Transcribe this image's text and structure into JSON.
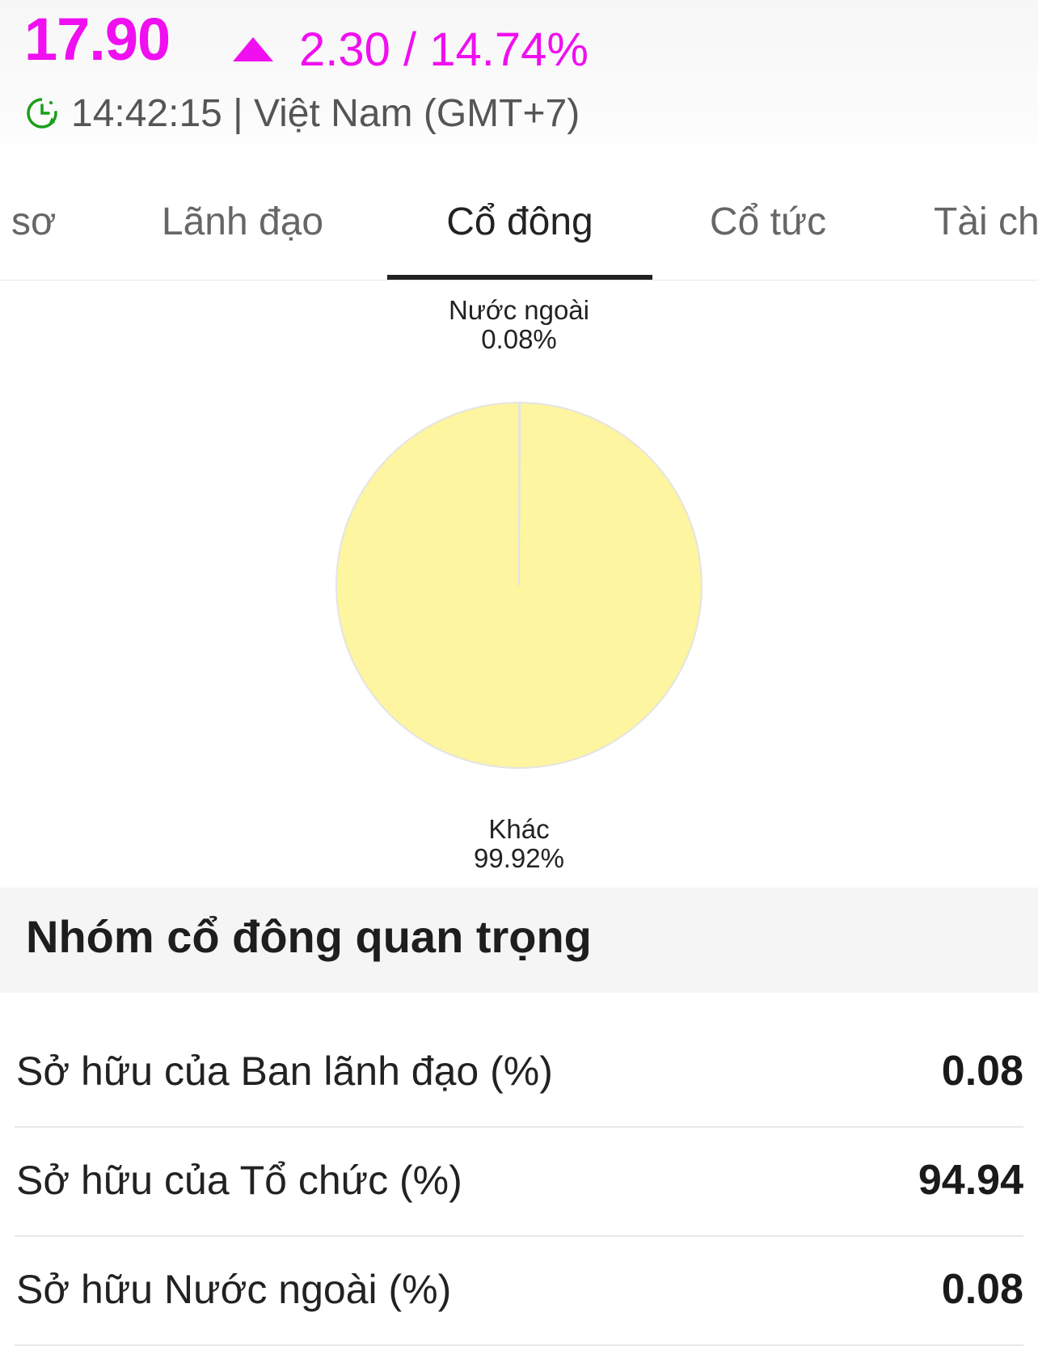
{
  "quote": {
    "price": "17.90",
    "change": "2.30 / 14.74%",
    "time": "14:42:15 | Việt Nam (GMT+7)",
    "color": "#f00ff0",
    "direction": "up"
  },
  "tabs": [
    {
      "label": "sơ",
      "active": false
    },
    {
      "label": "Lãnh đạo",
      "active": false
    },
    {
      "label": "Cổ đông",
      "active": true
    },
    {
      "label": "Cổ tức",
      "active": false
    },
    {
      "label": "Tài ch",
      "active": false
    }
  ],
  "chart_data": {
    "type": "pie",
    "slices": [
      {
        "label": "Nước ngoài",
        "value": 0.08,
        "display": "0.08%",
        "color": "#cfcfcf"
      },
      {
        "label": "Khác",
        "value": 99.92,
        "display": "99.92%",
        "color": "#fdf59f"
      }
    ]
  },
  "section": {
    "title": "Nhóm cổ đông quan trọng"
  },
  "ownership": [
    {
      "label": "Sở hữu của Ban lãnh đạo (%)",
      "value": "0.08"
    },
    {
      "label": "Sở hữu của Tổ chức (%)",
      "value": "94.94"
    },
    {
      "label": "Sở hữu Nước ngoài (%)",
      "value": "0.08"
    }
  ]
}
